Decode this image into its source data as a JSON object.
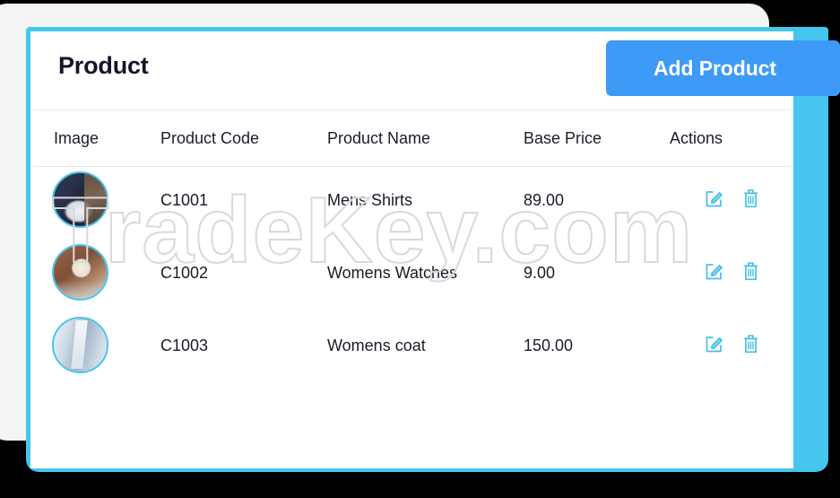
{
  "page": {
    "title": "Product",
    "watermark": "TradeKey.com"
  },
  "toolbar": {
    "add_product_label": "Add Product"
  },
  "table": {
    "columns": [
      {
        "key": "image",
        "label": "Image"
      },
      {
        "key": "code",
        "label": "Product Code"
      },
      {
        "key": "name",
        "label": "Product Name"
      },
      {
        "key": "price",
        "label": "Base Price"
      },
      {
        "key": "actions",
        "label": "Actions"
      }
    ],
    "rows": [
      {
        "image": "mens-shirt-thumbnail",
        "code": "C1001",
        "name": "Mens Shirts",
        "price": "89.00",
        "edit_label": "edit-icon",
        "delete_label": "trash-icon"
      },
      {
        "image": "womens-watch-thumbnail",
        "code": "C1002",
        "name": "Womens Watches",
        "price": "9.00",
        "edit_label": "edit-icon",
        "delete_label": "trash-icon"
      },
      {
        "image": "womens-coat-thumbnail",
        "code": "C1003",
        "name": "Womens coat",
        "price": "150.00",
        "edit_label": "edit-icon",
        "delete_label": "trash-icon"
      }
    ]
  },
  "colors": {
    "accent_cyan": "#45c6ef",
    "button_blue": "#3d9bf7",
    "icon_blue": "#49bfe8",
    "text_dark": "#1b1b29",
    "divider": "#e6e7e9",
    "backdrop_gray": "#f4f4f5",
    "page_background": "#000000",
    "watermark_outline": "#d7d9dc"
  }
}
